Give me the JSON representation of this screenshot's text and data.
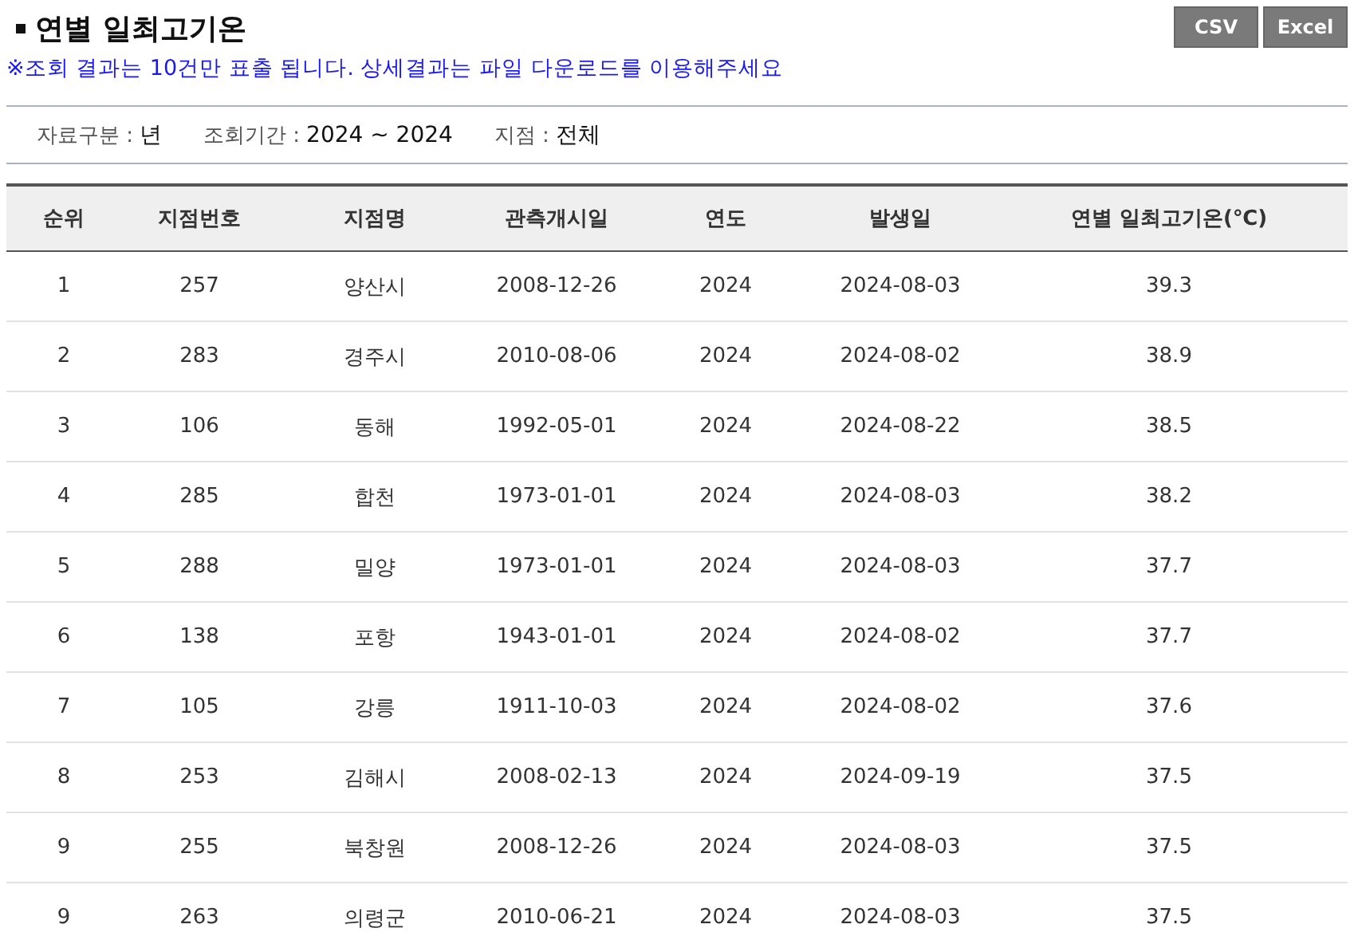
{
  "title": "연별 일최고기온",
  "buttons": [
    "CSV",
    "Excel"
  ],
  "notice": "※조회 결과는 10건만 표출 됩니다. 상세결과는 파일 다운로드를 이용해주세요",
  "filters": [
    {
      "label": "자료구분 :",
      "value": "년"
    },
    {
      "label": "조회기간 :",
      "value": "2024 ~ 2024"
    },
    {
      "label": "지점 :",
      "value": "전체"
    }
  ],
  "table": {
    "columns": [
      "순위",
      "지점번호",
      "지점명",
      "관측개시일",
      "연도",
      "발생일",
      "연별 일최고기온(℃)"
    ],
    "rows": [
      [
        "1",
        "257",
        "양산시",
        "2008-12-26",
        "2024",
        "2024-08-03",
        "39.3"
      ],
      [
        "2",
        "283",
        "경주시",
        "2010-08-06",
        "2024",
        "2024-08-02",
        "38.9"
      ],
      [
        "3",
        "106",
        "동해",
        "1992-05-01",
        "2024",
        "2024-08-22",
        "38.5"
      ],
      [
        "4",
        "285",
        "합천",
        "1973-01-01",
        "2024",
        "2024-08-03",
        "38.2"
      ],
      [
        "5",
        "288",
        "밀양",
        "1973-01-01",
        "2024",
        "2024-08-03",
        "37.7"
      ],
      [
        "6",
        "138",
        "포항",
        "1943-01-01",
        "2024",
        "2024-08-02",
        "37.7"
      ],
      [
        "7",
        "105",
        "강릉",
        "1911-10-03",
        "2024",
        "2024-08-02",
        "37.6"
      ],
      [
        "8",
        "253",
        "김해시",
        "2008-02-13",
        "2024",
        "2024-09-19",
        "37.5"
      ],
      [
        "9",
        "255",
        "북창원",
        "2008-12-26",
        "2024",
        "2024-08-03",
        "37.5"
      ],
      [
        "9",
        "263",
        "의령군",
        "2010-06-21",
        "2024",
        "2024-08-03",
        "37.5"
      ]
    ]
  }
}
